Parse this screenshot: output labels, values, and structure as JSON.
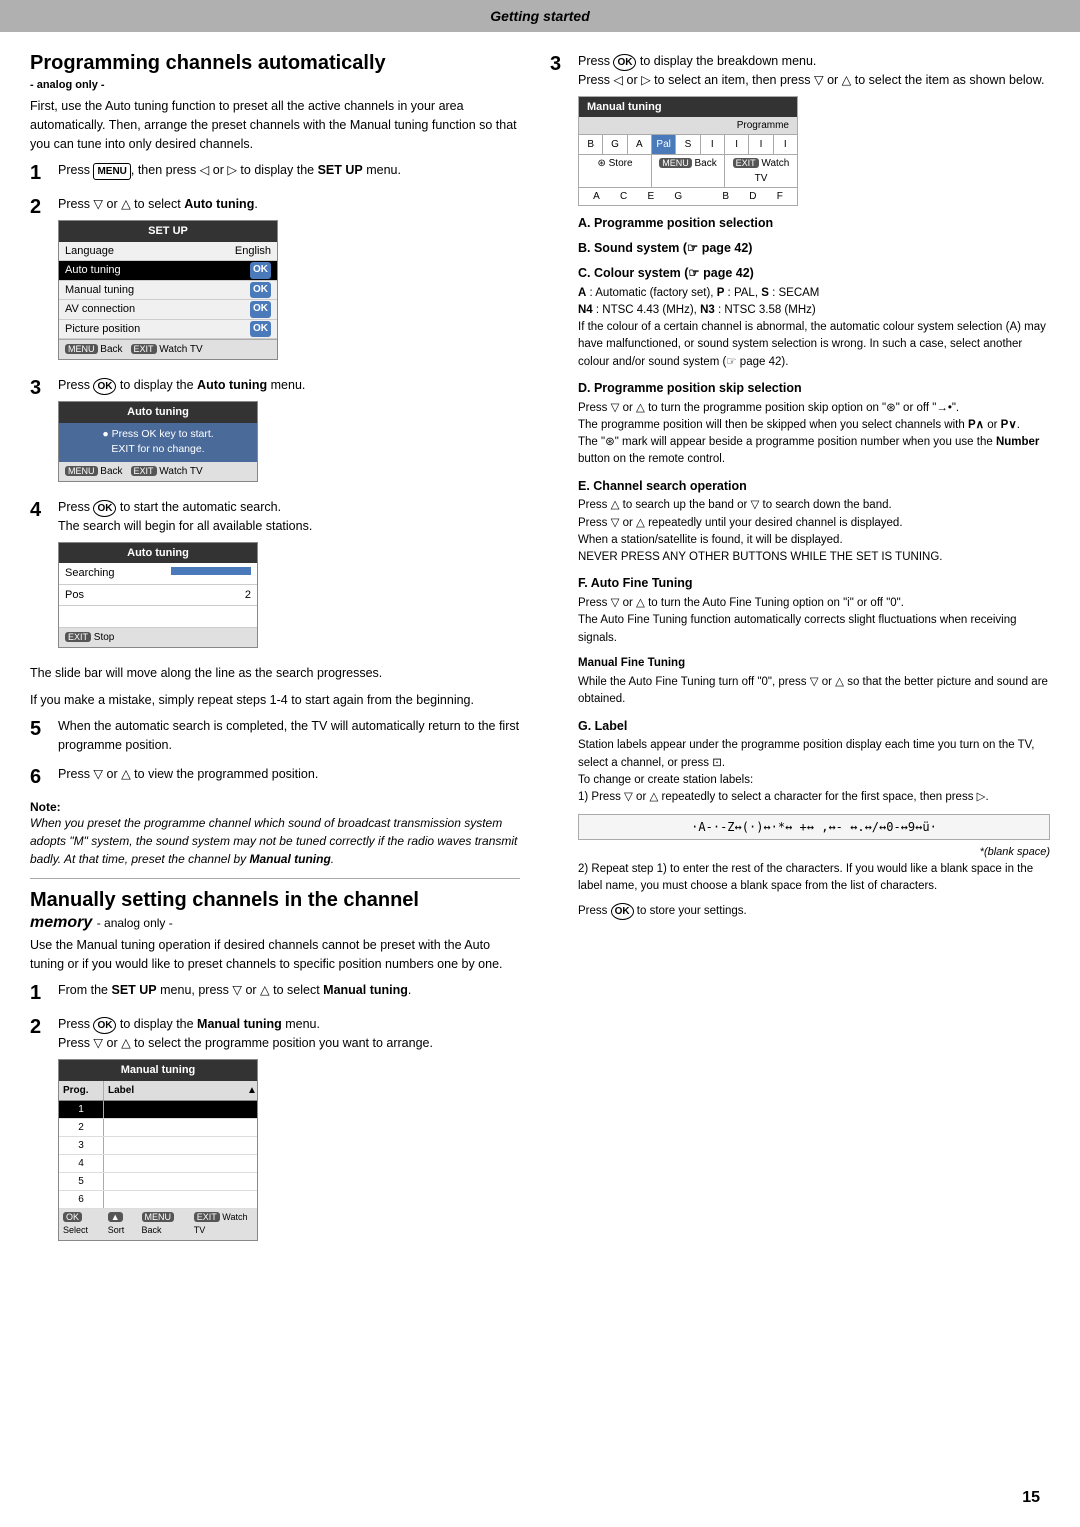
{
  "page": {
    "header": "Getting started",
    "page_number": "15"
  },
  "left_column": {
    "section1_title": "Programming channels automatically",
    "analog_only": "- analog only -",
    "intro": "First, use the Auto tuning function to preset all the active channels in your area automatically. Then, arrange the preset channels with the Manual tuning function so that you can tune into only desired channels.",
    "steps": [
      {
        "number": "1",
        "text": "Press",
        "key": "MENU",
        "text2": ", then press",
        "key2": "◁",
        "text3": "or",
        "key3": "▷",
        "text4": "to display the",
        "bold": "SET UP",
        "text5": "menu."
      },
      {
        "number": "2",
        "text": "Press",
        "key": "▽",
        "text2": "or",
        "key2": "△",
        "text3": "to select",
        "bold": "Auto tuning",
        "text4": "."
      },
      {
        "number": "3",
        "text": "Press",
        "key": "OK",
        "text2": "to display the",
        "bold": "Auto tuning",
        "text3": "menu."
      },
      {
        "number": "4",
        "text": "Press",
        "key": "OK",
        "text2": "to start the automatic search.",
        "sub": "The search will begin for all available stations."
      }
    ],
    "setup_menu": {
      "title": "SET UP",
      "rows": [
        {
          "label": "Language",
          "value": "English"
        },
        {
          "label": "Auto tuning",
          "value": "OK",
          "selected": true
        },
        {
          "label": "Manual tuning",
          "value": "OK"
        },
        {
          "label": "AV connection",
          "value": "OK"
        },
        {
          "label": "Picture position",
          "value": "OK"
        }
      ],
      "footer": [
        "MENU Back",
        "EXIT Watch TV"
      ]
    },
    "auto_tuning_menu": {
      "title": "Auto tuning",
      "body1": "Press OK key to start.",
      "body2": "EXIT for no change.",
      "footer": [
        "MENU Back",
        "EXIT Watch TV"
      ]
    },
    "search_menu": {
      "title": "Auto tuning",
      "rows": [
        {
          "label": "Searching",
          "value": ""
        },
        {
          "label": "Pos",
          "value": "2"
        },
        {
          "label": "",
          "value": ""
        }
      ],
      "footer": [
        "EXIT Stop"
      ]
    },
    "slide_bar_text": "The slide bar will move along the line as the search progresses.",
    "mistake_text": "If you make a mistake, simply repeat steps 1-4 to start again from the beginning.",
    "step5_text": "When the automatic search is completed, the TV will automatically return to the first programme position.",
    "step6_text": "Press",
    "step6_key": "▽",
    "step6_text2": "or",
    "step6_key2": "△",
    "step6_text3": "to view the programmed position.",
    "note_label": "Note:",
    "note_text": "When you preset the programme channel which sound of broadcast transmission system adopts \"M\" system, the sound system may not be tuned correctly if the radio waves transmit badly. At that time, preset the channel by",
    "note_bold": "Manual tuning",
    "note_end": ".",
    "section2_title": "Manually setting channels in the channel",
    "memory_label": "memory",
    "memory_analog": " - analog only -",
    "manual_intro": "Use the Manual tuning operation if desired channels cannot be preset with the Auto tuning or if you would like to preset channels to specific position numbers one by one.",
    "manual_steps": [
      {
        "number": "1",
        "text": "From the",
        "bold1": "SET UP",
        "text2": "menu, press",
        "key1": "▽",
        "text3": "or",
        "key2": "△",
        "text4": "to select",
        "bold2": "Manual tuning",
        "text5": "."
      },
      {
        "number": "2",
        "text": "Press",
        "key": "OK",
        "text2": "to display the",
        "bold": "Manual tuning",
        "text3": "menu.",
        "sub": "Press ▽ or △ to select the programme position you want to arrange."
      }
    ],
    "manual_tuning_table": {
      "title": "Manual tuning",
      "col1": "Prog.",
      "col2": "Label",
      "rows": [
        "1",
        "2",
        "3",
        "4",
        "5",
        "6"
      ],
      "footer": [
        "OK Select",
        "▲ Sort",
        "MENU Back",
        "EXIT Watch TV"
      ]
    }
  },
  "right_column": {
    "step3_text": "Press",
    "step3_key": "OK",
    "step3_text2": "to display the breakdown menu.",
    "step3_sub1": "Press ◁ or ▷ to select an item, then press ▽ or △ to select the item as shown below.",
    "manual_tuning_diagram": {
      "title": "Manual tuning",
      "prog_label": "Programme",
      "grid_labels": [
        "B",
        "G",
        "A",
        "Pal",
        "S",
        "I",
        "I",
        "I",
        "I"
      ],
      "row2": [
        "G Store",
        "MENU Back",
        "EXIT Watch TV"
      ],
      "letters_bottom": [
        "A",
        "C",
        "E",
        "G",
        "B",
        "D",
        "F"
      ]
    },
    "items": [
      {
        "label": "A. Programme position selection"
      },
      {
        "label": "B. Sound system (☞ page 42)"
      },
      {
        "label": "C. Colour system (☞ page 42)",
        "sub": "A : Automatic (factory set), P : PAL, S : SECAM\nN4 : NTSC 4.43 (MHz), N3 : NTSC 3.58 (MHz)\nIf the colour of a certain channel is abnormal, the automatic colour system selection (A) may have malfunctioned, or sound system selection is wrong. In such a case, select another colour and/or sound system (☞ page 42)."
      },
      {
        "label": "D. Programme position skip selection",
        "sub": "Press ▽ or △ to turn the programme position skip option on \"⊛\" or off \"→•\".\nThe programme position will then be skipped when you select channels with P∧ or P∨.\nThe \"⊛\" mark will appear beside a programme position number when you use the Number button on the remote control."
      },
      {
        "label": "E. Channel search operation",
        "sub": "Press △ to search up the band or ▽ to search down the band.\nPress ▽ or △ repeatedly until your desired channel is displayed.\nWhen a station/satellite is found, it will be displayed.\nNEVER PRESS ANY OTHER BUTTONS WHILE THE SET IS TUNING."
      },
      {
        "label": "F. Auto Fine Tuning",
        "sub": "Press ▽ or △ to turn the Auto Fine Tuning option on \"i\" or off \"0\".\nThe Auto Fine Tuning function automatically corrects slight fluctuations when receiving signals.",
        "sub2_label": "Manual Fine Tuning",
        "sub2": "While the Auto Fine Tuning turn off \"0\", press ▽ or △ so that the better picture and sound are obtained."
      },
      {
        "label": "G. Label",
        "sub": "Station labels appear under the programme position display each time you turn on the TV, select a channel, or press ⊡.\nTo change or create station labels:\n1) Press ▽ or △ repeatedly to select a character for the first space, then press ▷.",
        "chars_label": "·A-·-Z↔(·)↔·*↔ +↔ ,↔- ↔.↔/↔0-↔9↔ü·",
        "blank_space": "*(blank space)",
        "sub3": "2) Repeat step 1) to enter the rest of the characters. If you would like a blank space in the label name, you must choose a blank space from the list of characters."
      }
    ],
    "final_text": "Press",
    "final_key": "OK",
    "final_text2": "to store your settings."
  }
}
